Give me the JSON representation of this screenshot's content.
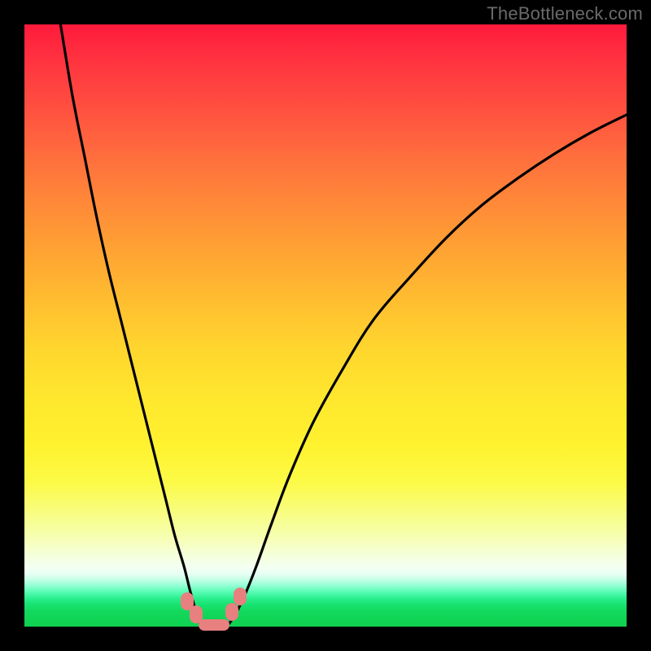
{
  "watermark": "TheBottleneck.com",
  "colors": {
    "background": "#000000",
    "curve": "#000000",
    "marker": "#e88080"
  },
  "chart_data": {
    "type": "line",
    "title": "",
    "xlabel": "",
    "ylabel": "",
    "xlim": [
      0,
      100
    ],
    "ylim": [
      0,
      100
    ],
    "grid": false,
    "annotations": [],
    "series": [
      {
        "name": "left-branch",
        "x": [
          6,
          8,
          10,
          12,
          14,
          16,
          18,
          20,
          22,
          23.5,
          25,
          26.5,
          27.5,
          28.2,
          28.8,
          29.2
        ],
        "y": [
          100,
          88,
          78,
          68,
          59,
          51,
          43,
          35,
          27,
          21,
          15,
          10,
          6,
          3.5,
          1.5,
          0.5
        ]
      },
      {
        "name": "right-branch",
        "x": [
          34,
          35,
          36.5,
          38.5,
          41,
          44,
          48,
          53,
          58,
          64,
          70,
          76,
          82,
          88,
          94,
          100
        ],
        "y": [
          0.5,
          2,
          5,
          10,
          17,
          25,
          34,
          43,
          51,
          58,
          64.5,
          70,
          74.5,
          78.5,
          82,
          85
        ]
      }
    ],
    "markers": [
      {
        "name": "flat-bottom",
        "x": 31.5,
        "y": 0.3,
        "shape": "hbar"
      },
      {
        "name": "left-blob-low",
        "x": 28.5,
        "y": 2.0,
        "shape": "blob"
      },
      {
        "name": "left-blob-high",
        "x": 27.0,
        "y": 4.2,
        "shape": "blob"
      },
      {
        "name": "right-blob-low",
        "x": 34.5,
        "y": 2.5,
        "shape": "blob"
      },
      {
        "name": "right-blob-high",
        "x": 35.8,
        "y": 5.0,
        "shape": "blob"
      }
    ]
  }
}
